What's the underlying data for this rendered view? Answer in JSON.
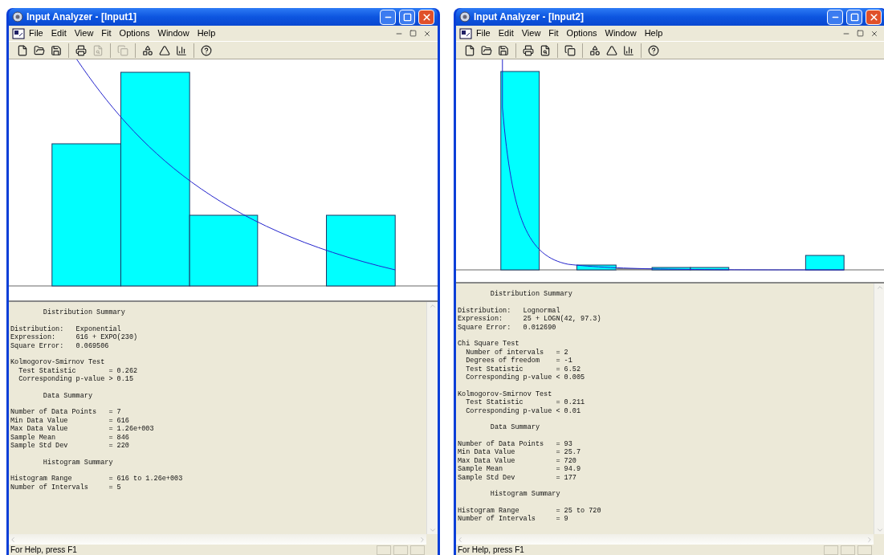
{
  "windows": [
    {
      "title": "Input Analyzer - [Input1]",
      "menu": [
        "File",
        "Edit",
        "View",
        "Fit",
        "Options",
        "Window",
        "Help"
      ],
      "toolbar": [
        {
          "kind": "new",
          "disabled": false
        },
        {
          "kind": "open",
          "disabled": false
        },
        {
          "kind": "save",
          "disabled": false
        },
        {
          "kind": "sep"
        },
        {
          "kind": "print",
          "disabled": false
        },
        {
          "kind": "preview",
          "disabled": true
        },
        {
          "kind": "sep"
        },
        {
          "kind": "copy",
          "disabled": true
        },
        {
          "kind": "sep"
        },
        {
          "kind": "fit",
          "disabled": false
        },
        {
          "kind": "distribution",
          "disabled": false
        },
        {
          "kind": "histogram",
          "disabled": false
        },
        {
          "kind": "sep"
        },
        {
          "kind": "help",
          "disabled": false
        }
      ],
      "report": [
        [
          "        Distribution Summary"
        ],
        [
          "Distribution:   Exponential",
          "Expression:     616 + EXPO(230)",
          "Square Error:   0.069506"
        ],
        [
          "Kolmogorov-Smirnov Test",
          "  Test Statistic        = 0.262",
          "  Corresponding p-value > 0.15"
        ],
        [
          "        Data Summary"
        ],
        [
          "Number of Data Points   = 7",
          "Min Data Value          = 616",
          "Max Data Value          = 1.26e+003",
          "Sample Mean             = 846",
          "Sample Std Dev          = 220"
        ],
        [
          "        Histogram Summary"
        ],
        [
          "Histogram Range         = 616 to 1.26e+003",
          "Number of Intervals     = 5"
        ]
      ],
      "status": "For Help, press F1"
    },
    {
      "title": "Input Analyzer - [Input2]",
      "menu": [
        "File",
        "Edit",
        "View",
        "Fit",
        "Options",
        "Window",
        "Help"
      ],
      "toolbar": [
        {
          "kind": "new",
          "disabled": false
        },
        {
          "kind": "open",
          "disabled": false
        },
        {
          "kind": "save",
          "disabled": false
        },
        {
          "kind": "sep"
        },
        {
          "kind": "print",
          "disabled": false
        },
        {
          "kind": "preview",
          "disabled": false
        },
        {
          "kind": "sep"
        },
        {
          "kind": "copy",
          "disabled": false
        },
        {
          "kind": "sep"
        },
        {
          "kind": "fit",
          "disabled": false
        },
        {
          "kind": "distribution",
          "disabled": false
        },
        {
          "kind": "histogram",
          "disabled": false
        },
        {
          "kind": "sep"
        },
        {
          "kind": "help",
          "disabled": false
        }
      ],
      "report": [
        [
          "        Distribution Summary"
        ],
        [
          "Distribution:   Lognormal",
          "Expression:     25 + LOGN(42, 97.3)",
          "Square Error:   0.012690"
        ],
        [
          "Chi Square Test",
          "  Number of intervals   = 2",
          "  Degrees of freedom    = -1",
          "  Test Statistic        = 6.52",
          "  Corresponding p-value < 0.005"
        ],
        [
          "Kolmogorov-Smirnov Test",
          "  Test Statistic        = 0.211",
          "  Corresponding p-value < 0.01"
        ],
        [
          "        Data Summary"
        ],
        [
          "Number of Data Points   = 93",
          "Min Data Value          = 25.7",
          "Max Data Value          = 720",
          "Sample Mean             = 94.9",
          "Sample Std Dev          = 177"
        ],
        [
          "        Histogram Summary"
        ],
        [
          "Histogram Range         = 25 to 720",
          "Number of Intervals     = 9"
        ]
      ],
      "status": "For Help, press F1"
    }
  ]
}
